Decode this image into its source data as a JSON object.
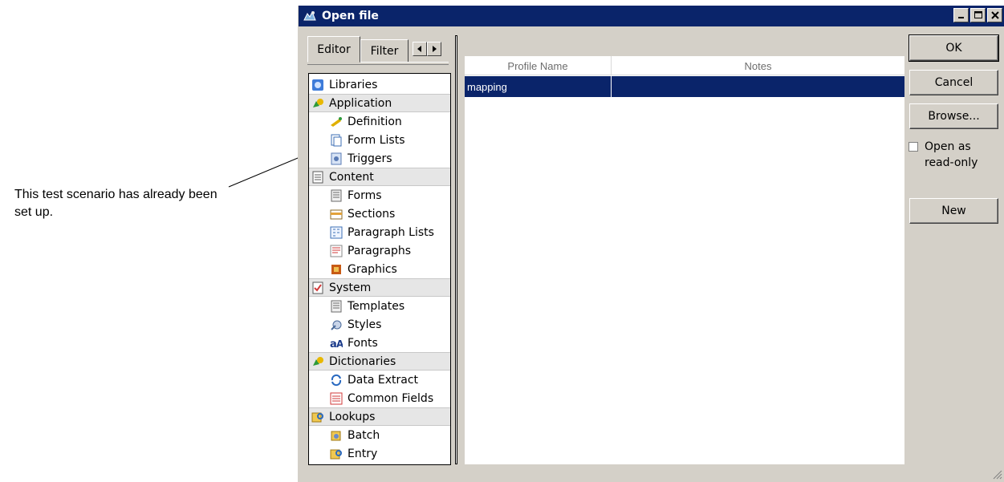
{
  "annotation": {
    "text": "This test scenario has already been set up."
  },
  "window": {
    "title": "Open file",
    "controls": {
      "minimize": "minimize-icon",
      "maximize": "maximize-icon",
      "close": "close-icon"
    }
  },
  "tabs": {
    "editor": "Editor",
    "filter": "Filter"
  },
  "tree": {
    "items": [
      {
        "label": "Libraries",
        "icon": "libraries-icon",
        "kind": "top"
      },
      {
        "label": "Application",
        "icon": "application-icon",
        "kind": "group"
      },
      {
        "label": "Definition",
        "icon": "definition-icon",
        "kind": "child"
      },
      {
        "label": "Form Lists",
        "icon": "form-lists-icon",
        "kind": "child"
      },
      {
        "label": "Triggers",
        "icon": "triggers-icon",
        "kind": "child"
      },
      {
        "label": "Content",
        "icon": "content-icon",
        "kind": "group"
      },
      {
        "label": "Forms",
        "icon": "forms-icon",
        "kind": "child"
      },
      {
        "label": "Sections",
        "icon": "sections-icon",
        "kind": "child"
      },
      {
        "label": "Paragraph Lists",
        "icon": "paragraph-lists-icon",
        "kind": "child"
      },
      {
        "label": "Paragraphs",
        "icon": "paragraphs-icon",
        "kind": "child"
      },
      {
        "label": "Graphics",
        "icon": "graphics-icon",
        "kind": "child"
      },
      {
        "label": "System",
        "icon": "system-icon",
        "kind": "group"
      },
      {
        "label": "Templates",
        "icon": "templates-icon",
        "kind": "child"
      },
      {
        "label": "Styles",
        "icon": "styles-icon",
        "kind": "child"
      },
      {
        "label": "Fonts",
        "icon": "fonts-icon",
        "kind": "child"
      },
      {
        "label": "Dictionaries",
        "icon": "dictionaries-icon",
        "kind": "group"
      },
      {
        "label": "Data Extract",
        "icon": "data-extract-icon",
        "kind": "child"
      },
      {
        "label": "Common Fields",
        "icon": "common-fields-icon",
        "kind": "child"
      },
      {
        "label": "Lookups",
        "icon": "lookups-icon",
        "kind": "group"
      },
      {
        "label": "Batch",
        "icon": "batch-icon",
        "kind": "child"
      },
      {
        "label": "Entry",
        "icon": "entry-icon",
        "kind": "child"
      }
    ]
  },
  "list": {
    "columns": [
      "Profile Name",
      "Notes"
    ],
    "rows": [
      {
        "profile_name": "mapping",
        "notes": "",
        "selected": true
      }
    ]
  },
  "buttons": {
    "ok": "OK",
    "cancel": "Cancel",
    "browse": "Browse...",
    "new": "New"
  },
  "options": {
    "read_only_label": "Open as read-only",
    "read_only_checked": false
  },
  "colors": {
    "titlebar": "#0a246a",
    "selection": "#0a246a",
    "face": "#d4d0c8"
  }
}
